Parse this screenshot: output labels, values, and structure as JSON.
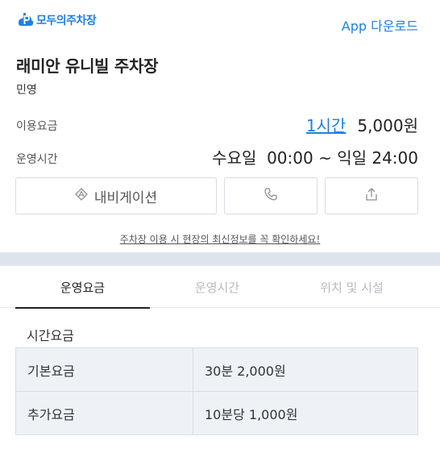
{
  "header": {
    "logo_text": "모두의주차장",
    "app_download": "App 다운로드"
  },
  "parking": {
    "name": "래미안 유니빌 주차장",
    "type": "민영"
  },
  "fee": {
    "label": "이용요금",
    "duration": "1시간",
    "price": "5,000원"
  },
  "hours": {
    "label": "운영시간",
    "value": "수요일  00:00 ~ 익일 24:00"
  },
  "actions": {
    "navigation_label": "내비게이션",
    "call_icon": "phone-icon",
    "share_icon": "share-icon",
    "navigation_icon": "navigation-diamond-icon"
  },
  "notice": "주차장 이용 시 현장의 최신정보를 꼭 확인하세요!",
  "tabs": [
    {
      "label": "운영요금",
      "active": true
    },
    {
      "label": "운영시간",
      "active": false
    },
    {
      "label": "위치 및 시설",
      "active": false
    }
  ],
  "fee_section": {
    "title": "시간요금",
    "rows": [
      {
        "label": "기본요금",
        "value": "30분 2,000원"
      },
      {
        "label": "추가요금",
        "value": "10분당 1,000원"
      }
    ]
  },
  "colors": {
    "brand": "#1f7fe0",
    "band": "#dfe4ec",
    "table_bg": "#eef2f6"
  }
}
